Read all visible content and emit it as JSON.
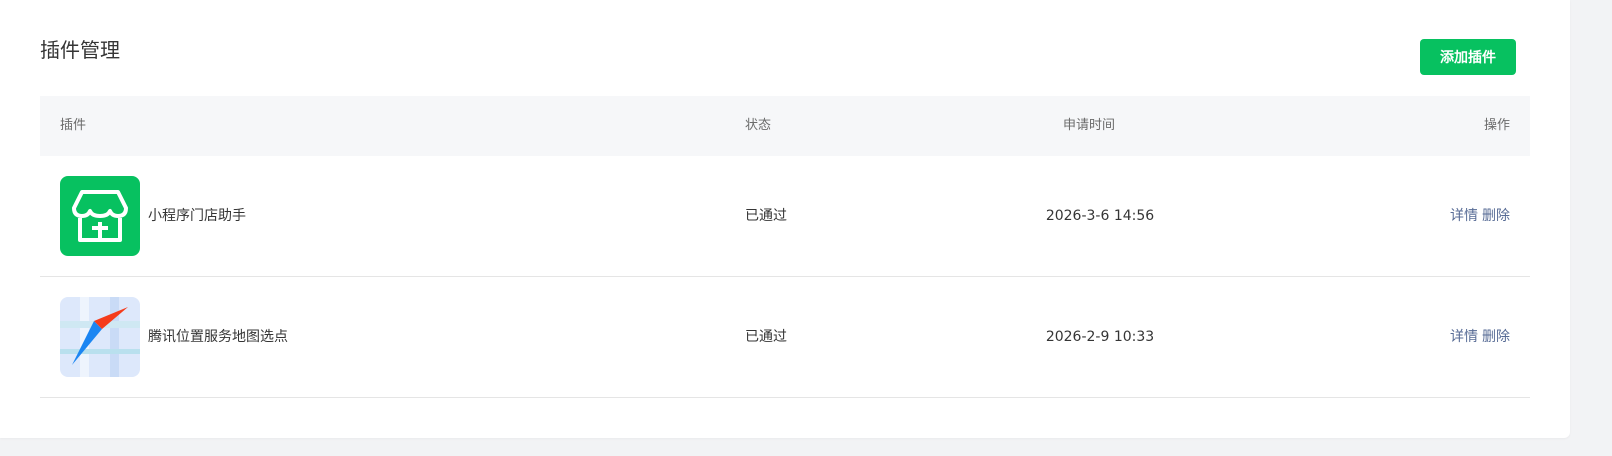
{
  "header": {
    "title": "插件管理",
    "add_button_label": "添加插件"
  },
  "table": {
    "columns": {
      "plugin": "插件",
      "status": "状态",
      "time": "申请时间",
      "ops": "操作"
    },
    "rows": [
      {
        "icon": "store-icon",
        "name": "小程序门店助手",
        "status": "已通过",
        "time": "2026-3-6 14:56",
        "detail_label": "详情",
        "delete_label": "删除"
      },
      {
        "icon": "map-compass-icon",
        "name": "腾讯位置服务地图选点",
        "status": "已通过",
        "time": "2026-2-9 10:33",
        "detail_label": "详情",
        "delete_label": "删除"
      }
    ]
  },
  "colors": {
    "brand_green": "#07c160",
    "link": "#576b95",
    "header_bg": "#f6f7f9"
  }
}
